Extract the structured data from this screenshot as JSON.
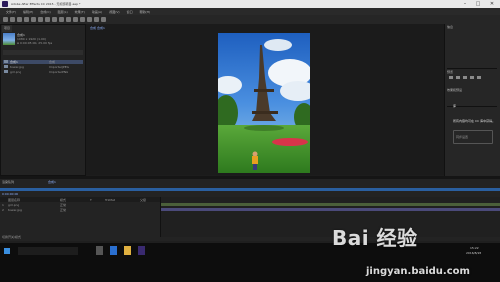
{
  "window": {
    "title": "Adobe After Effects CC 2015 - 无标题项目.aep *",
    "minimize": "–",
    "maximize": "□",
    "close": "✕"
  },
  "menu": [
    "文件(F)",
    "编辑(E)",
    "合成(C)",
    "图层(L)",
    "效果(T)",
    "动画(A)",
    "视图(V)",
    "窗口",
    "帮助(H)"
  ],
  "toolbar": {
    "tools": [
      "home-icon",
      "arrow-icon",
      "hand-icon",
      "zoom-icon",
      "rotate-icon",
      "camera-icon",
      "pan-icon",
      "rect-icon",
      "pen-icon",
      "text-icon",
      "brush-icon",
      "stamp-icon",
      "eraser-icon",
      "roto-icon",
      "pin-icon"
    ],
    "workspace_tab": "合成: 合成1"
  },
  "project": {
    "tab": "项目",
    "item_name": "合成1",
    "item_info": "1080 x 1920 (1.00)",
    "item_duration": "Δ 0:00:05:00, 25.00 fps",
    "rows": [
      {
        "name": "合成1",
        "type": "合成"
      },
      {
        "name": "tower.jpg",
        "type": "ImporterJPEG"
      },
      {
        "name": "girl.png",
        "type": "ImporterPNG"
      }
    ]
  },
  "viewer": {
    "tab": "合成 合成1",
    "zoom": "24.3%",
    "time": "0:00:00:00",
    "quality": "四分之一",
    "view": "活动摄像机",
    "views": "1个视图"
  },
  "right_panel": {
    "info_tab": "信息",
    "preview_tab": "预览",
    "effects_tab": "效果和预设",
    "lib_title": "库",
    "lib_desc": "所有内容均可在 CC 库中获得。",
    "lib_button": "同步设置"
  },
  "timeline": {
    "tab": "合成1",
    "render_tab": "渲染队列",
    "time": "0:00:00:00",
    "columns": [
      "图层名称",
      "模式",
      "T",
      "TrkMat",
      "父级"
    ],
    "layers": [
      {
        "num": "1",
        "name": "girl.png",
        "mode": "正常"
      },
      {
        "num": "2",
        "name": "tower.jpg",
        "mode": "正常"
      }
    ],
    "status": "切换开关/模式"
  },
  "taskbar": {
    "clock": "15:22",
    "date": "2016/8/26"
  },
  "watermark": {
    "logo": "Bai 经验",
    "url": "jingyan.baidu.com"
  }
}
